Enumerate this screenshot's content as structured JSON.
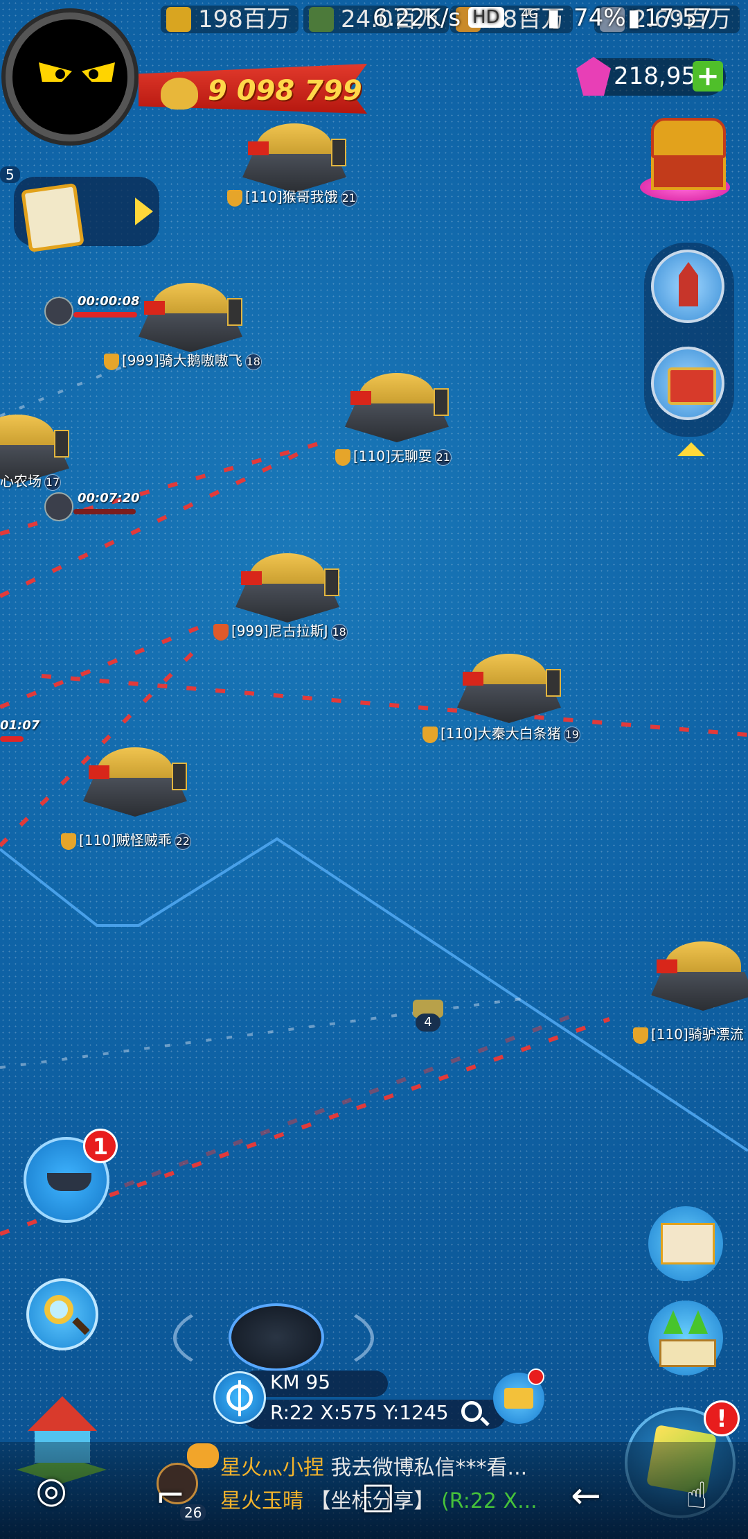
{
  "status_bar": {
    "resources": [
      {
        "icon": "gold-bars-icon",
        "value": "198百万"
      },
      {
        "icon": "fuel-barrel-icon",
        "value": "24.0百万"
      },
      {
        "icon": "oil-icon",
        "value": "38百万"
      },
      {
        "icon": "steel-icon",
        "value": "2.69百万"
      }
    ],
    "network_speed": "6.22K/s",
    "hd_badge": "HD",
    "signal": "4G",
    "battery": "74%",
    "time": "17:57"
  },
  "player": {
    "power": "9 098 799",
    "gems": "218,959",
    "add_gems_label": "+"
  },
  "left_panel": {
    "reinforcement_count": "5"
  },
  "map": {
    "bases": [
      {
        "id": "b1",
        "label": "[110]猴哥我饿",
        "level": "21"
      },
      {
        "id": "b2",
        "label": "[999]骑大鹅嗷嗷飞",
        "level": "18"
      },
      {
        "id": "b3",
        "label": "[110]无聊耍",
        "level": "21"
      },
      {
        "id": "b4",
        "label": "心农场",
        "level": "17"
      },
      {
        "id": "b5",
        "label": "[999]尼古拉斯J",
        "level": "18"
      },
      {
        "id": "b6",
        "label": "[110]大秦大白条猪",
        "level": "19"
      },
      {
        "id": "b7",
        "label": "[110]贼怪贼乖",
        "level": "22"
      },
      {
        "id": "b8",
        "label": "[110]骑驴漂流",
        "level": ""
      }
    ],
    "timers": [
      "00:00:08",
      "00:07:20",
      "01:07"
    ],
    "unit_count": "4"
  },
  "buttons": {
    "fleet_badge": "1",
    "alert_badge": "!"
  },
  "coords": {
    "kingdom": "KM 95",
    "position": "R:22 X:575 Y:1245"
  },
  "chat": {
    "messages": [
      {
        "name": "星火灬小捏",
        "text": "我去微博私信***看..."
      },
      {
        "name": "星火玉晴",
        "text": "【坐标分享】",
        "extra": "(R:22 X..."
      }
    ],
    "count": "26"
  },
  "navbar": {
    "recent_icon": "⌐",
    "home_icon": "□",
    "back_icon": "←"
  }
}
